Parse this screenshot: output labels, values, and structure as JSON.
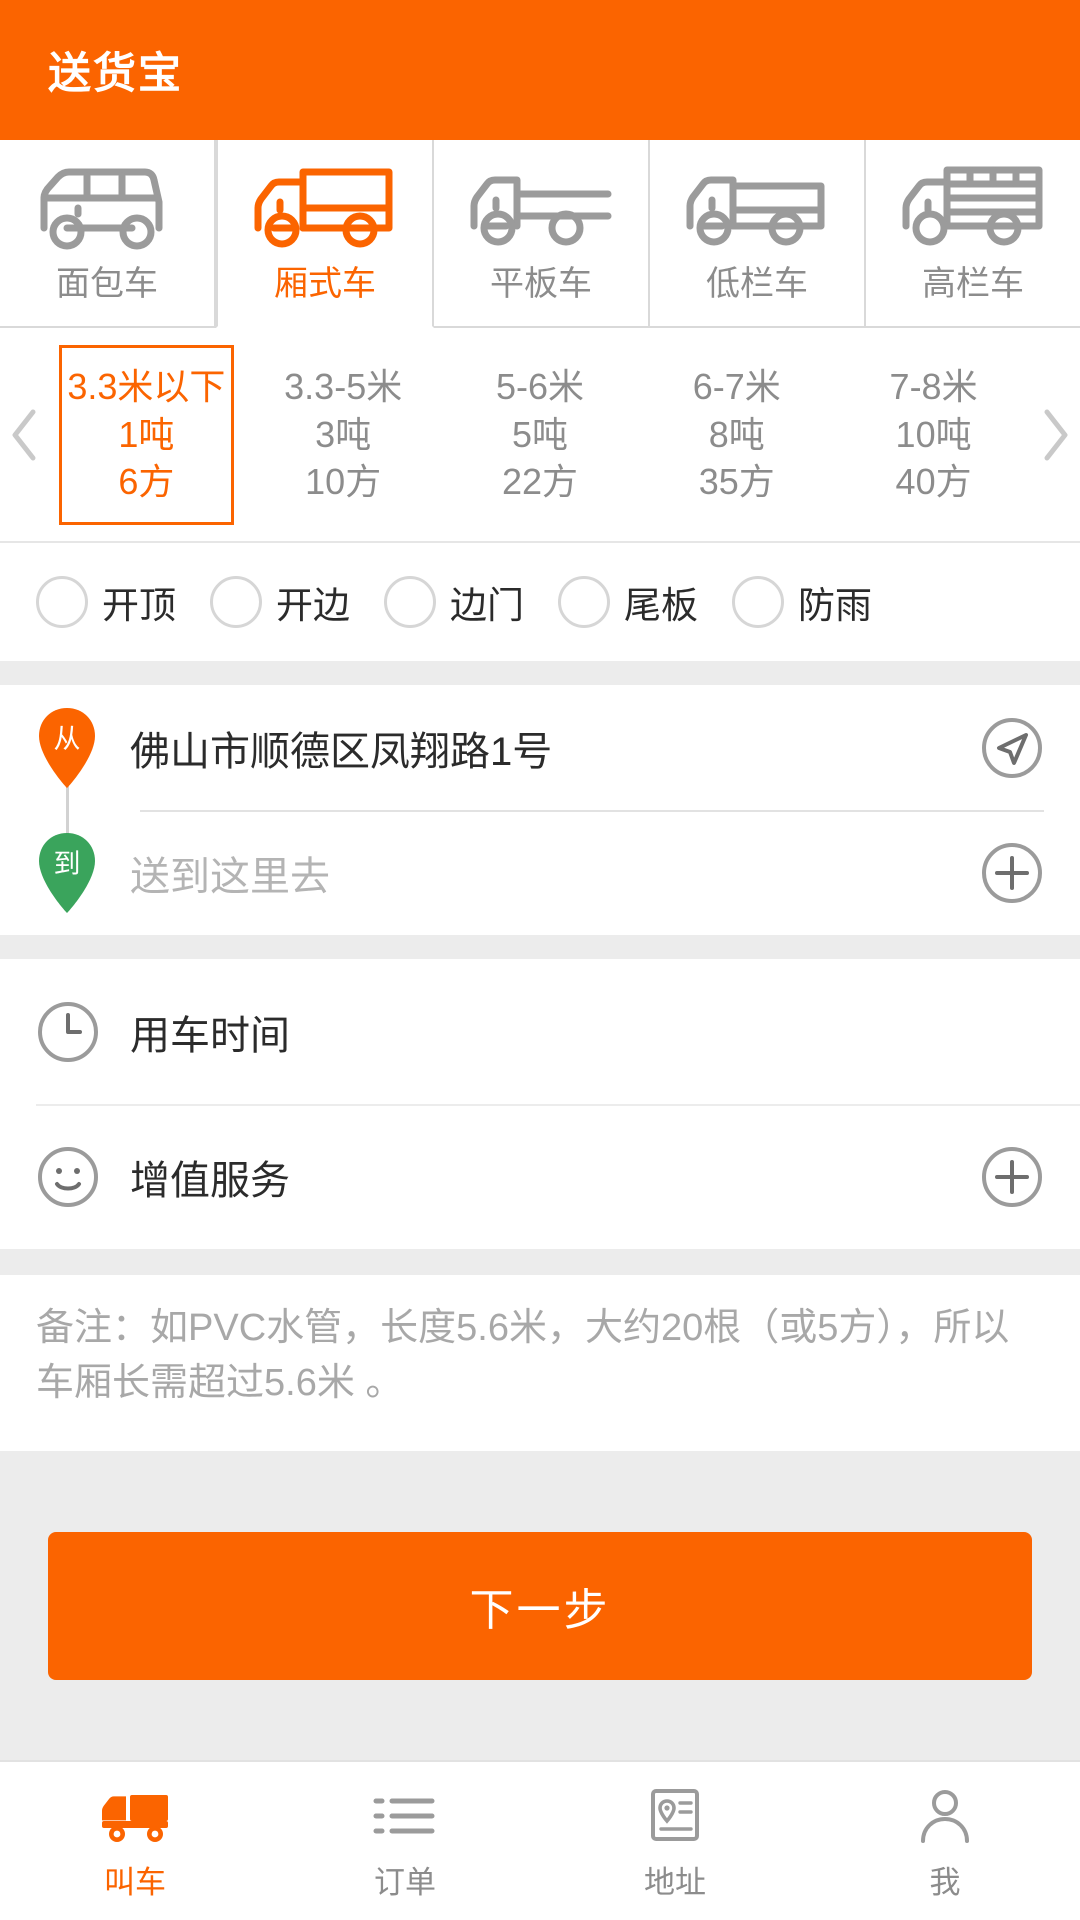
{
  "header": {
    "title": "送货宝",
    "bg_color": "#fb6400",
    "text_color": "#ffffff"
  },
  "colors": {
    "accent": "#fb6400",
    "muted": "#8c8c8c",
    "green": "#3aa45c",
    "divider": "#e2e2e2"
  },
  "vehicle_tabs": [
    {
      "label": "面包车",
      "icon": "van-icon",
      "selected": false
    },
    {
      "label": "厢式车",
      "icon": "box-truck-icon",
      "selected": true
    },
    {
      "label": "平板车",
      "icon": "flatbed-truck-icon",
      "selected": false
    },
    {
      "label": "低栏车",
      "icon": "low-rail-truck-icon",
      "selected": false
    },
    {
      "label": "高栏车",
      "icon": "high-rail-truck-icon",
      "selected": false
    }
  ],
  "size_options": {
    "prev_arrow_icon": "chevron-left-icon",
    "next_arrow_icon": "chevron-right-icon",
    "items": [
      {
        "length": "3.3米以下",
        "weight": "1吨",
        "volume": "6方",
        "selected": true
      },
      {
        "length": "3.3-5米",
        "weight": "3吨",
        "volume": "10方",
        "selected": false
      },
      {
        "length": "5-6米",
        "weight": "5吨",
        "volume": "22方",
        "selected": false
      },
      {
        "length": "6-7米",
        "weight": "8吨",
        "volume": "35方",
        "selected": false
      },
      {
        "length": "7-8米",
        "weight": "10吨",
        "volume": "40方",
        "selected": false
      }
    ]
  },
  "feature_options": [
    {
      "label": "开顶",
      "checked": false
    },
    {
      "label": "开边",
      "checked": false
    },
    {
      "label": "边门",
      "checked": false
    },
    {
      "label": "尾板",
      "checked": false
    },
    {
      "label": "防雨",
      "checked": false
    }
  ],
  "address": {
    "from": {
      "pin_label": "从",
      "value": "佛山市顺德区凤翔路1号",
      "action_icon": "locate-arrow-icon"
    },
    "to": {
      "pin_label": "到",
      "value": "",
      "placeholder": "送到这里去",
      "action_icon": "plus-circle-icon"
    }
  },
  "list_rows": [
    {
      "label": "用车时间",
      "icon": "clock-icon",
      "action_icon": ""
    },
    {
      "label": "增值服务",
      "icon": "smiley-icon",
      "action_icon": "plus-circle-icon"
    }
  ],
  "remark": {
    "text": "备注：如PVC水管，长度5.6米，大约20根（或5方），所以车厢长需超过5.6米 。"
  },
  "next_button": {
    "label": "下一步"
  },
  "bottom_nav": [
    {
      "label": "叫车",
      "icon": "truck-icon",
      "active": true
    },
    {
      "label": "订单",
      "icon": "list-icon",
      "active": false
    },
    {
      "label": "地址",
      "icon": "address-card-icon",
      "active": false
    },
    {
      "label": "我",
      "icon": "person-icon",
      "active": false
    }
  ]
}
